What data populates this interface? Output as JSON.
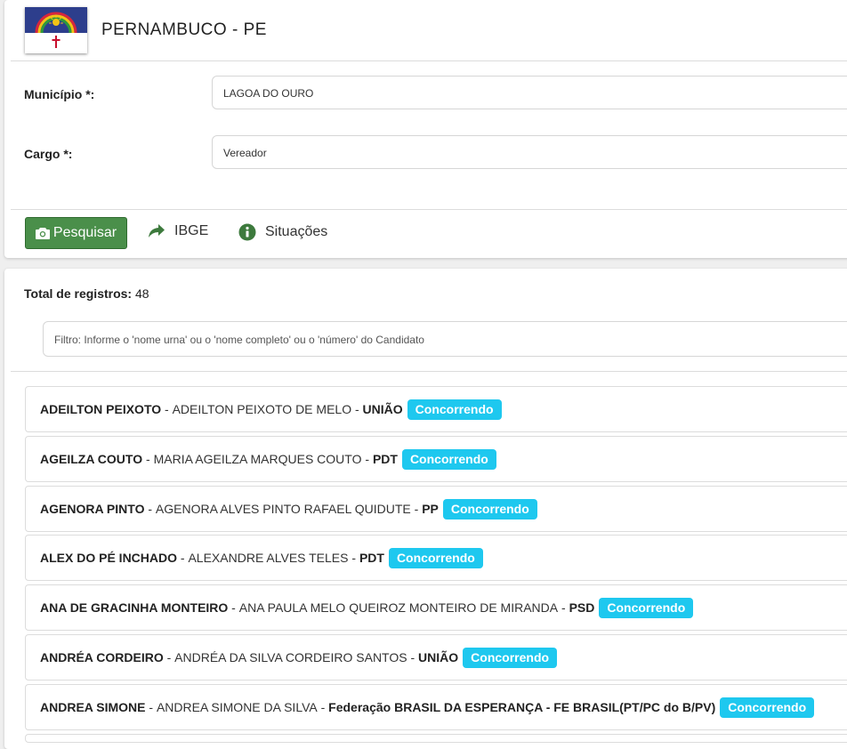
{
  "header": {
    "state_title": "PERNAMBUCO - PE",
    "flag_colors": {
      "blue": "#2d3e8c",
      "rainbow_red": "#d7263d",
      "rainbow_yellow": "#f3c316",
      "rainbow_green": "#2e9a3b",
      "cross": "#c8102e"
    }
  },
  "form": {
    "municipio_label": "Município *:",
    "municipio_value": "LAGOA DO OURO",
    "cargo_label": "Cargo *:",
    "cargo_value": "Vereador"
  },
  "toolbar": {
    "search_label": "Pesquisar",
    "ibge_label": "IBGE",
    "situacoes_label": "Situações"
  },
  "results": {
    "total_label": "Total de registros:",
    "total_value": "48",
    "filter_placeholder": "Filtro: Informe o 'nome urna' ou o 'nome completo' ou o 'número' do Candidato",
    "candidates": [
      {
        "urna": "ADEILTON PEIXOTO",
        "full": "ADEILTON PEIXOTO DE MELO",
        "party": "UNIÃO",
        "status": "Concorrendo"
      },
      {
        "urna": "AGEILZA COUTO",
        "full": "MARIA AGEILZA MARQUES COUTO",
        "party": "PDT",
        "status": "Concorrendo"
      },
      {
        "urna": "AGENORA PINTO",
        "full": "AGENORA ALVES PINTO RAFAEL QUIDUTE",
        "party": "PP",
        "status": "Concorrendo"
      },
      {
        "urna": "ALEX DO PÉ INCHADO",
        "full": "ALEXANDRE ALVES TELES",
        "party": "PDT",
        "status": "Concorrendo"
      },
      {
        "urna": "ANA DE GRACINHA MONTEIRO",
        "full": "ANA PAULA MELO QUEIROZ MONTEIRO DE MIRANDA",
        "party": "PSD",
        "status": "Concorrendo"
      },
      {
        "urna": "ANDRÉA CORDEIRO",
        "full": "ANDRÉA DA SILVA CORDEIRO SANTOS",
        "party": "UNIÃO",
        "status": "Concorrendo"
      },
      {
        "urna": "ANDREA SIMONE",
        "full": "ANDREA SIMONE DA SILVA",
        "party": "Federação BRASIL DA ESPERANÇA - FE BRASIL(PT/PC do B/PV)",
        "status": "Concorrendo"
      }
    ]
  }
}
